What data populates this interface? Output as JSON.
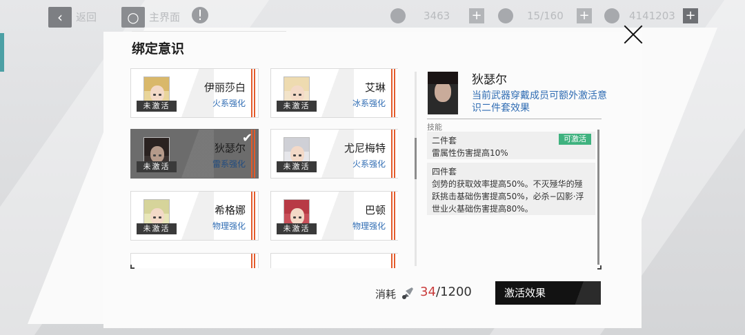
{
  "topbar": {
    "back_label": "返回",
    "home_label": "主界面",
    "stamina": "3463",
    "inventory": "15/160",
    "currency": "4141203"
  },
  "modal": {
    "title": "绑定意识"
  },
  "cards": [
    {
      "name": "伊丽莎白",
      "attr": "火系强化",
      "status": "未激活",
      "selected": false
    },
    {
      "name": "艾琳",
      "attr": "冰系强化",
      "status": "未激活",
      "selected": false
    },
    {
      "name": "狄瑟尔",
      "attr": "雷系强化",
      "status": "未激活",
      "selected": true
    },
    {
      "name": "尤尼梅特",
      "attr": "火系强化",
      "status": "未激活",
      "selected": false
    },
    {
      "name": "希格娜",
      "attr": "物理强化",
      "status": "未激活",
      "selected": false
    },
    {
      "name": "巴顿",
      "attr": "物理强化",
      "status": "未激活",
      "selected": false
    }
  ],
  "detail": {
    "name": "狄瑟尔",
    "desc": "当前武器穿戴成员可额外激活意识二件套效果",
    "skill_label": "技能",
    "set2_title": "二件套",
    "set2_badge": "可激活",
    "set2_text": "雷属性伤害提高10%",
    "set4_title": "四件套",
    "set4_text": "剑势的获取效率提高50%。不灭殛华的殛跃挑击基础伤害提高50%，必杀−囚影·浮世业火基础伤害提高80%。"
  },
  "footer": {
    "cost_label": "消耗",
    "cost_used": "34",
    "cost_total": "/1200",
    "activate_label": "激活效果"
  },
  "colors": {
    "accent_blue": "#2f6cb3",
    "badge_green": "#3fb27f",
    "stripe_orange": "#e35a2a",
    "cost_red": "#c93a3a"
  }
}
